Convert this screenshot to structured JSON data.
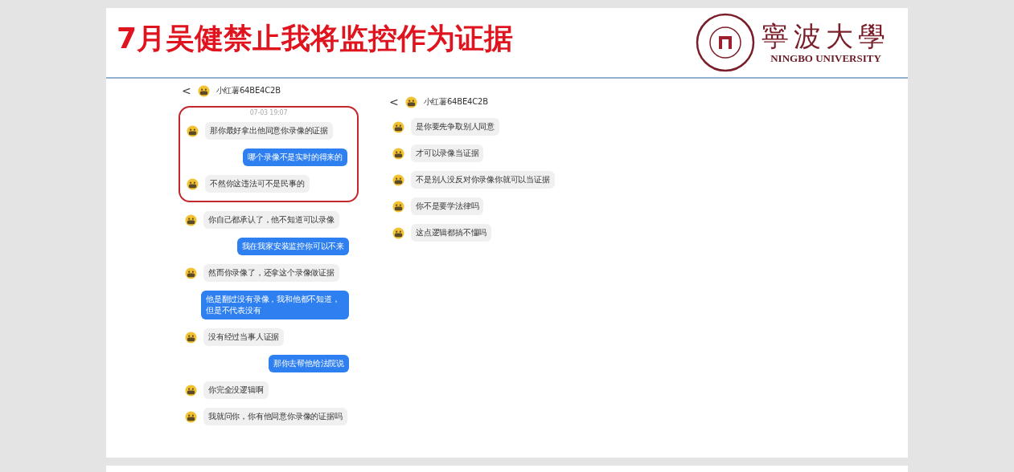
{
  "slide": {
    "title": "7月吴健禁止我将监控作为证据",
    "logo": {
      "chinese_name": "寧波大學",
      "english_name": "NINGBO UNIVERSITY"
    }
  },
  "left_chat": {
    "back": "<",
    "contact": "小红薯64BE4C2B",
    "circled": {
      "timestamp": "07-03 19:07",
      "messages": [
        {
          "kind": "received",
          "text": "那你最好拿出他同意你录像的证据"
        },
        {
          "kind": "sent",
          "text": "哪个录像不是实时的得来的"
        },
        {
          "kind": "received",
          "text": "不然你这违法可不是民事的"
        }
      ]
    },
    "messages": [
      {
        "kind": "received",
        "text": "你自己都承认了，他不知道可以录像"
      },
      {
        "kind": "sent",
        "text": "我在我家安装监控你可以不来"
      },
      {
        "kind": "received",
        "text": "然而你录像了，还拿这个录像做证据"
      },
      {
        "kind": "sent",
        "text": "他是翻过没有录像，我和他都不知道，但是不代表没有"
      },
      {
        "kind": "received",
        "text": "没有经过当事人证据"
      },
      {
        "kind": "sent",
        "text": "那你去帮他给法院说"
      },
      {
        "kind": "received",
        "text": "你完全没逻辑啊"
      },
      {
        "kind": "received",
        "text": "我就问你，你有他同意你录像的证据吗"
      }
    ]
  },
  "right_chat": {
    "back": "<",
    "contact": "小红薯64BE4C2B",
    "messages": [
      {
        "kind": "received",
        "text": "是你要先争取别人同意"
      },
      {
        "kind": "received",
        "text": "才可以录像当证据"
      },
      {
        "kind": "received",
        "text": "不是别人没反对你录像你就可以当证据"
      },
      {
        "kind": "received",
        "text": "你不是要学法律吗"
      },
      {
        "kind": "received",
        "text": "这点逻辑都搞不懂吗"
      }
    ]
  }
}
